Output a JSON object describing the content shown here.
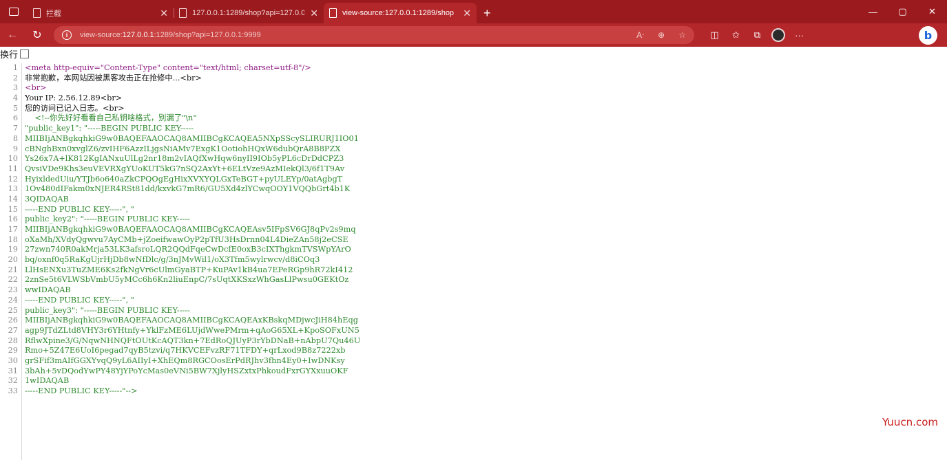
{
  "browser": {
    "tabs": [
      {
        "title": "拦截",
        "active": false
      },
      {
        "title": "127.0.0.1:1289/shop?api=127.0.0",
        "active": false
      },
      {
        "title": "view-source:127.0.0.1:1289/shop",
        "active": true
      }
    ],
    "new_tab": "+",
    "window_controls": {
      "minimize": "—",
      "maximize": "▢",
      "close": "✕"
    },
    "address": {
      "prefix": "view-source:",
      "host": "127.0.0.1",
      "rest": ":1289/shop?api=127.0.0.1:9999"
    },
    "colors": {
      "tab_strip": "#9b1a1e",
      "toolbar": "#b3272b",
      "omnibox": "#c8403f"
    }
  },
  "wrap_toggle": {
    "label": "换行",
    "checked": false
  },
  "source_lines": [
    {
      "n": "1",
      "text": "<meta http-equiv=\"Content-Type\" content=\"text/html; charset=utf-8\"/>",
      "style": "tag"
    },
    {
      "n": "2",
      "text": "非常抱歉，本网站因被黑客攻击正在抢修中...<br>",
      "style": "text"
    },
    {
      "n": "3",
      "text": "<br>",
      "style": "tag"
    },
    {
      "n": "4",
      "text": "Your IP: 2.56.12.89<br>",
      "style": "text"
    },
    {
      "n": "5",
      "text": "您的访问已记入日志。<br>",
      "style": "text"
    },
    {
      "n": "6",
      "text": "    <!--你先好好看看自己私钥啥格式，别漏了\"\\n\"",
      "style": "comment"
    },
    {
      "n": "7",
      "text": "\"public_key1\": \"-----BEGIN PUBLIC KEY-----",
      "style": "comment"
    },
    {
      "n": "8",
      "text": "MIIBIjANBgkqhkiG9w0BAQEFAAOCAQ8AMIIBCgKCAQEA5NXpSScySLIRURJ1IO01",
      "style": "comment"
    },
    {
      "n": "9",
      "text": "cBNghBxn0xvglZ6/zvIHF6AzzILjgsNiAMv7ExgK1OotiohHQxW6dubQrA8B8PZX",
      "style": "comment"
    },
    {
      "n": "10",
      "text": "Ys26x7A+lK812KgIANxuUlLg2nr18m2vIAQfXwHqw6nyII9IOb5yPL6cDrDdCPZ3",
      "style": "comment"
    },
    {
      "n": "11",
      "text": "QvsiVDe9Khs3euVEVRXgYUoKUT5kG7nSQ2AxYt+6ELtVze9AzMIekQl3/6f1T9Av",
      "style": "comment"
    },
    {
      "n": "12",
      "text": "HyixldedUiu/YTJb6o640aZkCPQOgEgHixXVXYQLGxTeBGT+pyULEYp/0atAgbgT",
      "style": "comment"
    },
    {
      "n": "13",
      "text": "1Ov480dIFakm0xNJER4RSt81dd/kxvkG7mR6/GU5Xd4zlYCwqOOY1VQQbGrt4b1K",
      "style": "comment"
    },
    {
      "n": "14",
      "text": "3QIDAQAB",
      "style": "comment"
    },
    {
      "n": "15",
      "text": "-----END PUBLIC KEY-----\", \"",
      "style": "comment"
    },
    {
      "n": "16",
      "text": "public_key2\": \"-----BEGIN PUBLIC KEY-----",
      "style": "comment"
    },
    {
      "n": "17",
      "text": "MIIBIjANBgkqhkiG9w0BAQEFAAOCAQ8AMIIBCgKCAQEAsv5IFpSV6GJ8qPv2s9mq",
      "style": "comment"
    },
    {
      "n": "18",
      "text": "oXaMh/XVdyQgwvu7AyCMb+jZoeifwawOyP2pTfU3HsDrnn04L4DieZAn58j2eCSE",
      "style": "comment"
    },
    {
      "n": "19",
      "text": "27zwn740R0akMrja53LK3afsroLQR2QQdFqeCwDcfE0oxB3cIXThgkmTVSWpYArO",
      "style": "comment"
    },
    {
      "n": "20",
      "text": "bq/oxnf0q5RaKgUjrHjDb8wNfDlc/g/3nJMvWil1/oX3Tfm5wylrwcv/d8iCOq3",
      "style": "comment"
    },
    {
      "n": "21",
      "text": "LlHsENXu3TuZME6Ks2fkNgVr6cUlmGyaBTP+KuPAv1kB4ua7EPeRGp9hR72kI412",
      "style": "comment"
    },
    {
      "n": "22",
      "text": "2znSe5t6VLWSbVmbU5yMCc6h6Kn2liuEnpC/7sUqtXKSxzWhGasLlPwsu0GEKtOz",
      "style": "comment"
    },
    {
      "n": "23",
      "text": "wwIDAQAB",
      "style": "comment"
    },
    {
      "n": "24",
      "text": "-----END PUBLIC KEY-----\", \"",
      "style": "comment"
    },
    {
      "n": "25",
      "text": "public_key3\": \"-----BEGIN PUBLIC KEY-----",
      "style": "comment"
    },
    {
      "n": "26",
      "text": "MIIBIjANBgkqhkiG9w0BAQEFAAOCAQ8AMIIBCgKCAQEAxKBskqMDjwcJiH84hEqg",
      "style": "comment"
    },
    {
      "n": "27",
      "text": "agp9JTdZLtd8VHY3r6YHtnfy+YklFzME6LUjdWwePMrm+qAoG65XL+KpoSOFxUN5",
      "style": "comment"
    },
    {
      "n": "28",
      "text": "RflwXpine3/G/NqwNHNQFtOUtKcAQT3kn+7EdRoQJUyP3rYbDNaB+nAbpU7Qu46U",
      "style": "comment"
    },
    {
      "n": "29",
      "text": "Rmo+5Z47E6UoI6pegad7qyB5tzvi/q7HKVCEFvzRF71TFDY+qrLxod9B8z7222xb",
      "style": "comment"
    },
    {
      "n": "30",
      "text": "grSFif3mAIfGGXYvqQ9yL6AIIyI+XhEQm8RGCOosErPdRJhv3fhn4Ey0+IwDNKsy",
      "style": "comment"
    },
    {
      "n": "31",
      "text": "3bAh+5vDQodYwPY48YjYPoYcMas0eVNi5BW7XjlyHSZxtxPhkoudFxrGYXxuuOKF",
      "style": "comment"
    },
    {
      "n": "32",
      "text": "1wIDAQAB",
      "style": "comment"
    },
    {
      "n": "33",
      "text": "-----END PUBLIC KEY-----\"-->",
      "style": "comment"
    }
  ],
  "watermark": "Yuucn.com"
}
